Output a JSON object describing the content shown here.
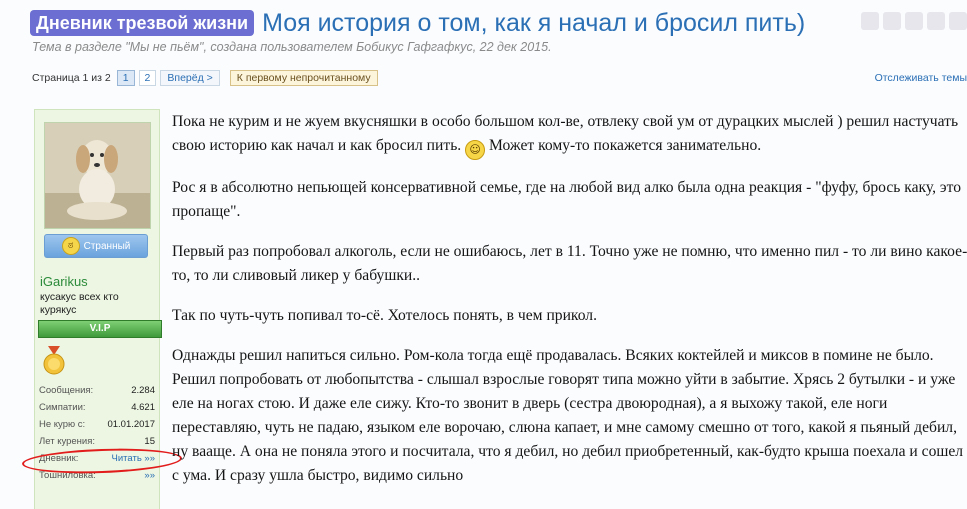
{
  "thread": {
    "prefix": "Дневник трезвой жизни",
    "title": "Моя история о том, как я начал и бросил пить)",
    "subtitle": "Тема в разделе \"Мы не пьём\", создана пользователем Бобикус Гафгафкус, 22 дек 2015."
  },
  "pager": {
    "label": "Страница 1 из 2",
    "pages": [
      "1",
      "2"
    ],
    "current": "1",
    "next": "Вперёд >",
    "first_unread": "К первому непрочитанному",
    "watch": "Отслеживать темы"
  },
  "user": {
    "mood": "Странный",
    "username": "iGarikus",
    "title": "кусакус всех кто курякус",
    "rank": "V.I.P",
    "stats": [
      {
        "label": "Сообщения:",
        "value": "2.284"
      },
      {
        "label": "Симпатии:",
        "value": "4.621"
      },
      {
        "label": "Не курю с:",
        "value": "01.01.2017"
      },
      {
        "label": "Лет курения:",
        "value": "15"
      },
      {
        "label": "Дневник:",
        "value": "Читать »»"
      },
      {
        "label": "Тошниловка:",
        "value": "»»"
      }
    ]
  },
  "post": {
    "p1a": "Пока не курим и не жуем вкусняшки в особо большом кол-ве, отвлеку свой ум от дурацких мыслей ) решил настучать свою историю как начал и как бросил пить.",
    "p1b": "Может кому-то покажется занимательно.",
    "p2": "Рос я в абсолютно непьющей консервативной семье, где на любой вид алко была одна реакция - \"фуфу, брось каку, это пропаще\".",
    "p3": "Первый раз попробовал алкоголь, если не ошибаюсь, лет в 11. Точно уже не помню, что именно пил - то ли вино какое-то, то ли сливовый ликер у бабушки..",
    "p4": "Так по чуть-чуть попивал то-сё. Хотелось понять, в чем прикол.",
    "p5": "Однажды решил напиться сильно. Ром-кола тогда ещё продавалась. Всяких коктейлей и миксов в помине не было. Решил попробовать от любопытства - слышал взрослые говорят типа можно уйти в забытие. Хрясь 2 бутылки - и уже еле на ногах стою. И даже еле сижу. Кто-то звонит в дверь (сестра двоюродная), а я выхожу такой, еле ноги переставляю, чуть не падаю, языком еле ворочаю, слюна капает, и мне самому смешно от того, какой я пьяный дебил, ну вааще. А она не поняла этого и посчитала, что я дебил, но дебил приобретенный, как-будто крыша поехала и сошел с ума. И сразу ушла быстро, видимо сильно"
  }
}
